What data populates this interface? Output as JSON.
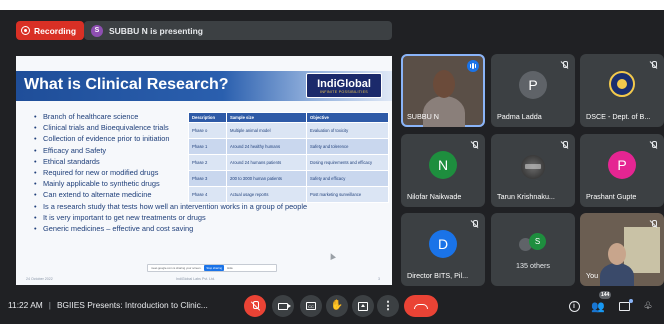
{
  "top_bar": {
    "recording_label": "Recording",
    "presenter_initial": "S",
    "presenter_text": "SUBBU N is presenting"
  },
  "slide": {
    "title": "What is Clinical Research?",
    "logo_name": "IndiGlobal",
    "logo_tagline": "INFINITE POSSIBILITIES",
    "bullets": [
      "Branch of healthcare science",
      "Clinical trials and Bioequivalence trials",
      "Collection of evidence prior to initiation",
      "Efficacy and Safety",
      "Ethical standards",
      "Required for new or modified drugs",
      "Mainly applicable to synthetic drugs",
      "Can extend to alternate medicine",
      "Is a research study that tests how well an intervention works in a group of people",
      "It is very important to get new treatments or drugs",
      "Generic medicines – effective and cost saving"
    ],
    "table_headers": [
      "Description",
      "Sample size",
      "Objective"
    ],
    "table_rows": [
      [
        "Phase o",
        "Multiple animal model",
        "Evaluation of toxicity"
      ],
      [
        "Phase 1",
        "Around 24 healthy humans",
        "Safety and tolerence"
      ],
      [
        "Phase 2",
        "Around 24 humans patients",
        "Dosing requirements and efficacy"
      ],
      [
        "Phase 3",
        "200 to 3000 human patients",
        "Safety and efficacy"
      ],
      [
        "Phase 4",
        "Actual usage reports",
        "Post marketing surveillance"
      ]
    ],
    "share_bar_text": "meet.google.com is sharing your screen.",
    "share_bar_stop": "Stop sharing",
    "share_bar_hide": "Hide",
    "footer_date": "24 October 2022",
    "footer_company": "IndiGlobal Labs Pvt. Ltd.",
    "footer_page": "3"
  },
  "participants": [
    {
      "name": "SUBBU N",
      "speaking": true
    },
    {
      "name": "Padma Ladda",
      "initial": "P",
      "color": "#5f6368"
    },
    {
      "name": "DSCE - Dept. of B..."
    },
    {
      "name": "Nilofar Naikwade",
      "initial": "N",
      "color": "#1e8e3e"
    },
    {
      "name": "Tarun Krishnaku..."
    },
    {
      "name": "Prashant Gupte",
      "initial": "P",
      "color": "#e52592"
    },
    {
      "name": "Director BITS, Pil...",
      "initial": "D",
      "color": "#1a73e8"
    },
    {
      "name": "135 others",
      "initial": "S"
    },
    {
      "name": "You"
    }
  ],
  "bottom_bar": {
    "time": "11:22 AM",
    "meeting_title": "BGIIES Presents: Introduction to Clinic...",
    "participant_count": "144"
  },
  "colors": {
    "background": "#202124",
    "tile": "#3c4043",
    "recording": "#d93025",
    "end_call": "#ea4335",
    "slide_title_bar": "#1f4e99"
  }
}
